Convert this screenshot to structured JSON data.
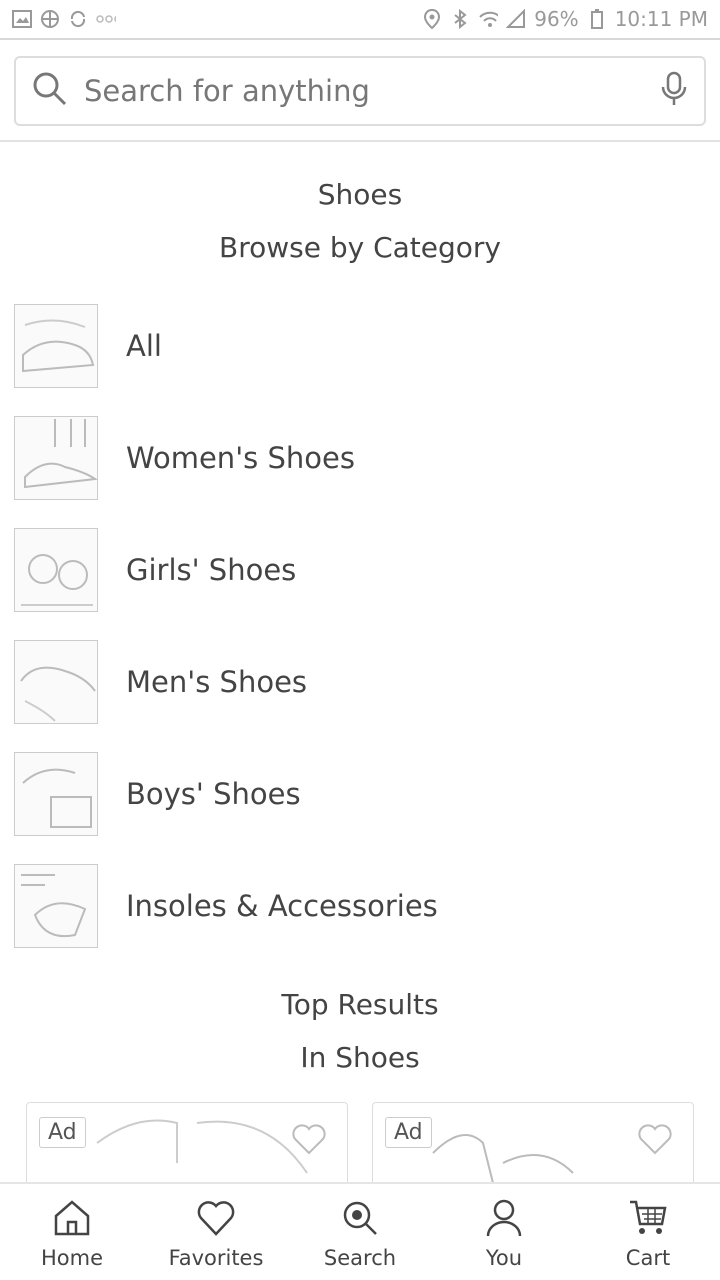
{
  "status_bar": {
    "battery": "96%",
    "time": "10:11 PM"
  },
  "search": {
    "placeholder": "Search for anything"
  },
  "category_section": {
    "title": "Shoes",
    "subtitle": "Browse by Category",
    "items": [
      {
        "label": "All"
      },
      {
        "label": "Women's Shoes"
      },
      {
        "label": "Girls' Shoes"
      },
      {
        "label": "Men's Shoes"
      },
      {
        "label": "Boys' Shoes"
      },
      {
        "label": "Insoles & Accessories"
      }
    ]
  },
  "results_section": {
    "title": "Top Results",
    "subtitle": "In Shoes",
    "cards": [
      {
        "badge": "Ad"
      },
      {
        "badge": "Ad"
      }
    ]
  },
  "bottom_nav": {
    "items": [
      {
        "label": "Home",
        "icon": "home-icon"
      },
      {
        "label": "Favorites",
        "icon": "heart-icon"
      },
      {
        "label": "Search",
        "icon": "search-icon"
      },
      {
        "label": "You",
        "icon": "user-icon"
      },
      {
        "label": "Cart",
        "icon": "cart-icon"
      }
    ]
  }
}
